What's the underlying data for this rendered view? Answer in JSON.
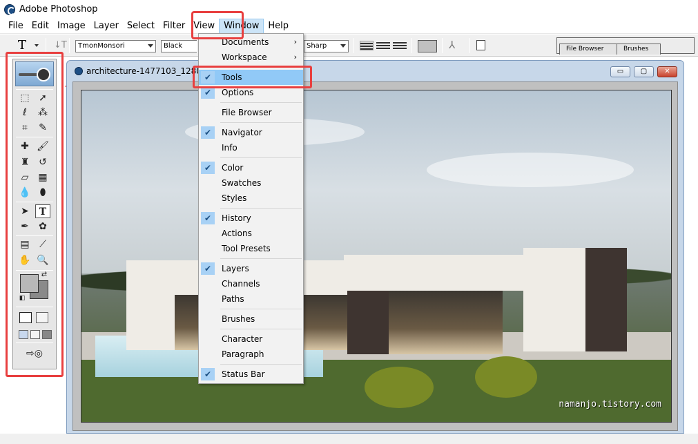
{
  "app": {
    "title": "Adobe Photoshop"
  },
  "menubar": {
    "items": [
      {
        "label": "File"
      },
      {
        "label": "Edit"
      },
      {
        "label": "Image"
      },
      {
        "label": "Layer"
      },
      {
        "label": "Select"
      },
      {
        "label": "Filter"
      },
      {
        "label": "View"
      },
      {
        "label": "Window"
      },
      {
        "label": "Help"
      }
    ]
  },
  "options": {
    "tool_glyph": "T",
    "font_family": "TmonMonsori",
    "font_style": "Black",
    "antialias": "Sharp",
    "palette_tabs": [
      "File Browser",
      "Brushes"
    ]
  },
  "document": {
    "title": "architecture-1477103_1280.j",
    "watermark": "namanjo.tistory.com"
  },
  "window_menu": {
    "items": [
      {
        "label": "Documents",
        "checked": false,
        "submenu": true
      },
      {
        "label": "Workspace",
        "checked": false,
        "submenu": true
      },
      {
        "label": "Tools",
        "checked": true,
        "submenu": false,
        "highlighted": true
      },
      {
        "label": "Options",
        "checked": true,
        "submenu": false
      },
      {
        "label": "File Browser",
        "checked": false,
        "submenu": false
      },
      {
        "label": "Navigator",
        "checked": true,
        "submenu": false
      },
      {
        "label": "Info",
        "checked": false,
        "submenu": false
      },
      {
        "label": "Color",
        "checked": true,
        "submenu": false
      },
      {
        "label": "Swatches",
        "checked": false,
        "submenu": false
      },
      {
        "label": "Styles",
        "checked": false,
        "submenu": false
      },
      {
        "label": "History",
        "checked": true,
        "submenu": false
      },
      {
        "label": "Actions",
        "checked": false,
        "submenu": false
      },
      {
        "label": "Tool Presets",
        "checked": false,
        "submenu": false
      },
      {
        "label": "Layers",
        "checked": true,
        "submenu": false
      },
      {
        "label": "Channels",
        "checked": false,
        "submenu": false
      },
      {
        "label": "Paths",
        "checked": false,
        "submenu": false
      },
      {
        "label": "Brushes",
        "checked": false,
        "submenu": false
      },
      {
        "label": "Character",
        "checked": false,
        "submenu": false
      },
      {
        "label": "Paragraph",
        "checked": false,
        "submenu": false
      },
      {
        "label": "Status Bar",
        "checked": true,
        "submenu": false
      }
    ]
  },
  "toolbox": {
    "tools": [
      "marquee-icon",
      "move-icon",
      "lasso-icon",
      "magic-wand-icon",
      "crop-icon",
      "slice-icon",
      "healing-brush-icon",
      "brush-icon",
      "clone-stamp-icon",
      "history-brush-icon",
      "eraser-icon",
      "gradient-icon",
      "blur-icon",
      "dodge-icon",
      "path-selection-icon",
      "type-icon",
      "pen-icon",
      "shape-icon",
      "notes-icon",
      "eyedropper-icon",
      "hand-icon",
      "zoom-icon"
    ],
    "foreground_color": "#b8b8b8",
    "background_color": "#8a8a8a"
  },
  "colors": {
    "highlight_red": "#e83f3f",
    "menu_highlight": "#91c9f7"
  }
}
